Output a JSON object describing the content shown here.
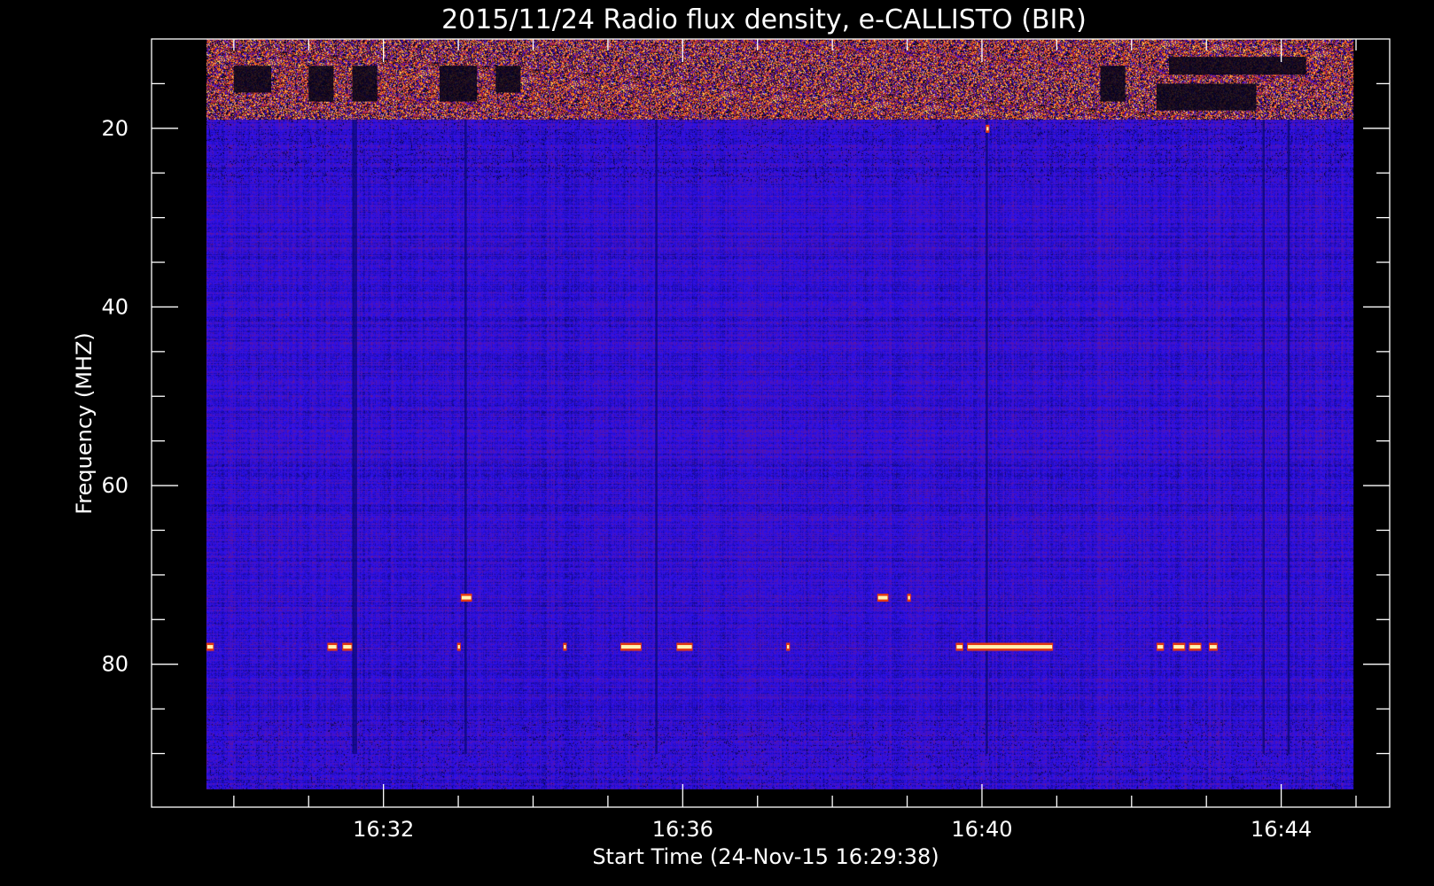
{
  "chart_data": {
    "type": "heatmap",
    "title": "2015/11/24  Radio flux density, e-CALLISTO (BIR)",
    "xlabel": "Start Time (24-Nov-15 16:29:38)",
    "ylabel": "Frequency (MHZ)",
    "x_range_minutes": [
      "16:28:54",
      "16:45:27"
    ],
    "data_x_range": [
      "16:29:38",
      "16:44:58"
    ],
    "ylim": [
      10,
      96
    ],
    "data_y_range": [
      10,
      94
    ],
    "y_inverted": true,
    "x_ticks": [
      {
        "value": "16:32",
        "label": "16:32"
      },
      {
        "value": "16:36",
        "label": "16:36"
      },
      {
        "value": "16:40",
        "label": "16:40"
      },
      {
        "value": "16:44",
        "label": "16:44"
      }
    ],
    "x_minor_ticks": [
      "16:30",
      "16:31",
      "16:32",
      "16:33",
      "16:34",
      "16:35",
      "16:36",
      "16:37",
      "16:38",
      "16:39",
      "16:40",
      "16:41",
      "16:42",
      "16:43",
      "16:44",
      "16:45"
    ],
    "y_ticks": [
      {
        "value": 20,
        "label": "20"
      },
      {
        "value": 40,
        "label": "40"
      },
      {
        "value": 60,
        "label": "60"
      },
      {
        "value": 80,
        "label": "80"
      }
    ],
    "y_minor_ticks": [
      15,
      20,
      25,
      30,
      35,
      40,
      45,
      50,
      55,
      60,
      65,
      70,
      75,
      80,
      85,
      90
    ],
    "colormap": [
      "#000000",
      "#10086e",
      "#2a10f0",
      "#6a1590",
      "#b0222a",
      "#e83a10",
      "#ff9a20",
      "#ffe690"
    ],
    "background_color": "#000000",
    "dominant_color": "#2a10f0",
    "features": {
      "rfi_band_mhz": [
        10,
        19
      ],
      "rfi_gaps": [
        {
          "start": "16:31:35",
          "end": "16:31:55",
          "f_low": 13,
          "f_high": 17
        },
        {
          "start": "16:30:00",
          "end": "16:30:30",
          "f_low": 13,
          "f_high": 16
        },
        {
          "start": "16:31:00",
          "end": "16:31:20",
          "f_low": 13,
          "f_high": 17
        },
        {
          "start": "16:32:45",
          "end": "16:33:15",
          "f_low": 13,
          "f_high": 17
        },
        {
          "start": "16:33:30",
          "end": "16:33:50",
          "f_low": 13,
          "f_high": 16
        },
        {
          "start": "16:41:35",
          "end": "16:41:55",
          "f_low": 13,
          "f_high": 17
        },
        {
          "start": "16:42:20",
          "end": "16:43:40",
          "f_low": 15,
          "f_high": 18
        },
        {
          "start": "16:42:30",
          "end": "16:44:20",
          "f_low": 12,
          "f_high": 14
        }
      ],
      "dark_columns": [
        "16:31:35",
        "16:31:37",
        "16:33:05",
        "16:35:38",
        "16:40:03",
        "16:43:45",
        "16:44:05"
      ],
      "bright_segments": [
        {
          "start": "16:29:38",
          "end": "16:29:44",
          "f": 78
        },
        {
          "start": "16:31:15",
          "end": "16:31:23",
          "f": 78
        },
        {
          "start": "16:31:27",
          "end": "16:31:35",
          "f": 78
        },
        {
          "start": "16:32:59",
          "end": "16:33:02",
          "f": 78
        },
        {
          "start": "16:34:24",
          "end": "16:34:27",
          "f": 78
        },
        {
          "start": "16:35:10",
          "end": "16:35:27",
          "f": 78
        },
        {
          "start": "16:35:55",
          "end": "16:36:08",
          "f": 78
        },
        {
          "start": "16:37:23",
          "end": "16:37:26",
          "f": 78
        },
        {
          "start": "16:39:39",
          "end": "16:39:45",
          "f": 78
        },
        {
          "start": "16:39:48",
          "end": "16:40:57",
          "f": 78
        },
        {
          "start": "16:42:20",
          "end": "16:42:26",
          "f": 78
        },
        {
          "start": "16:42:33",
          "end": "16:42:43",
          "f": 78
        },
        {
          "start": "16:42:46",
          "end": "16:42:56",
          "f": 78
        },
        {
          "start": "16:43:02",
          "end": "16:43:09",
          "f": 78
        },
        {
          "start": "16:33:02",
          "end": "16:33:11",
          "f": 72.5
        },
        {
          "start": "16:38:36",
          "end": "16:38:45",
          "f": 72.5
        },
        {
          "start": "16:39:00",
          "end": "16:39:03",
          "f": 72.5
        },
        {
          "start": "16:40:03",
          "end": "16:40:06",
          "f": 20
        }
      ]
    }
  }
}
